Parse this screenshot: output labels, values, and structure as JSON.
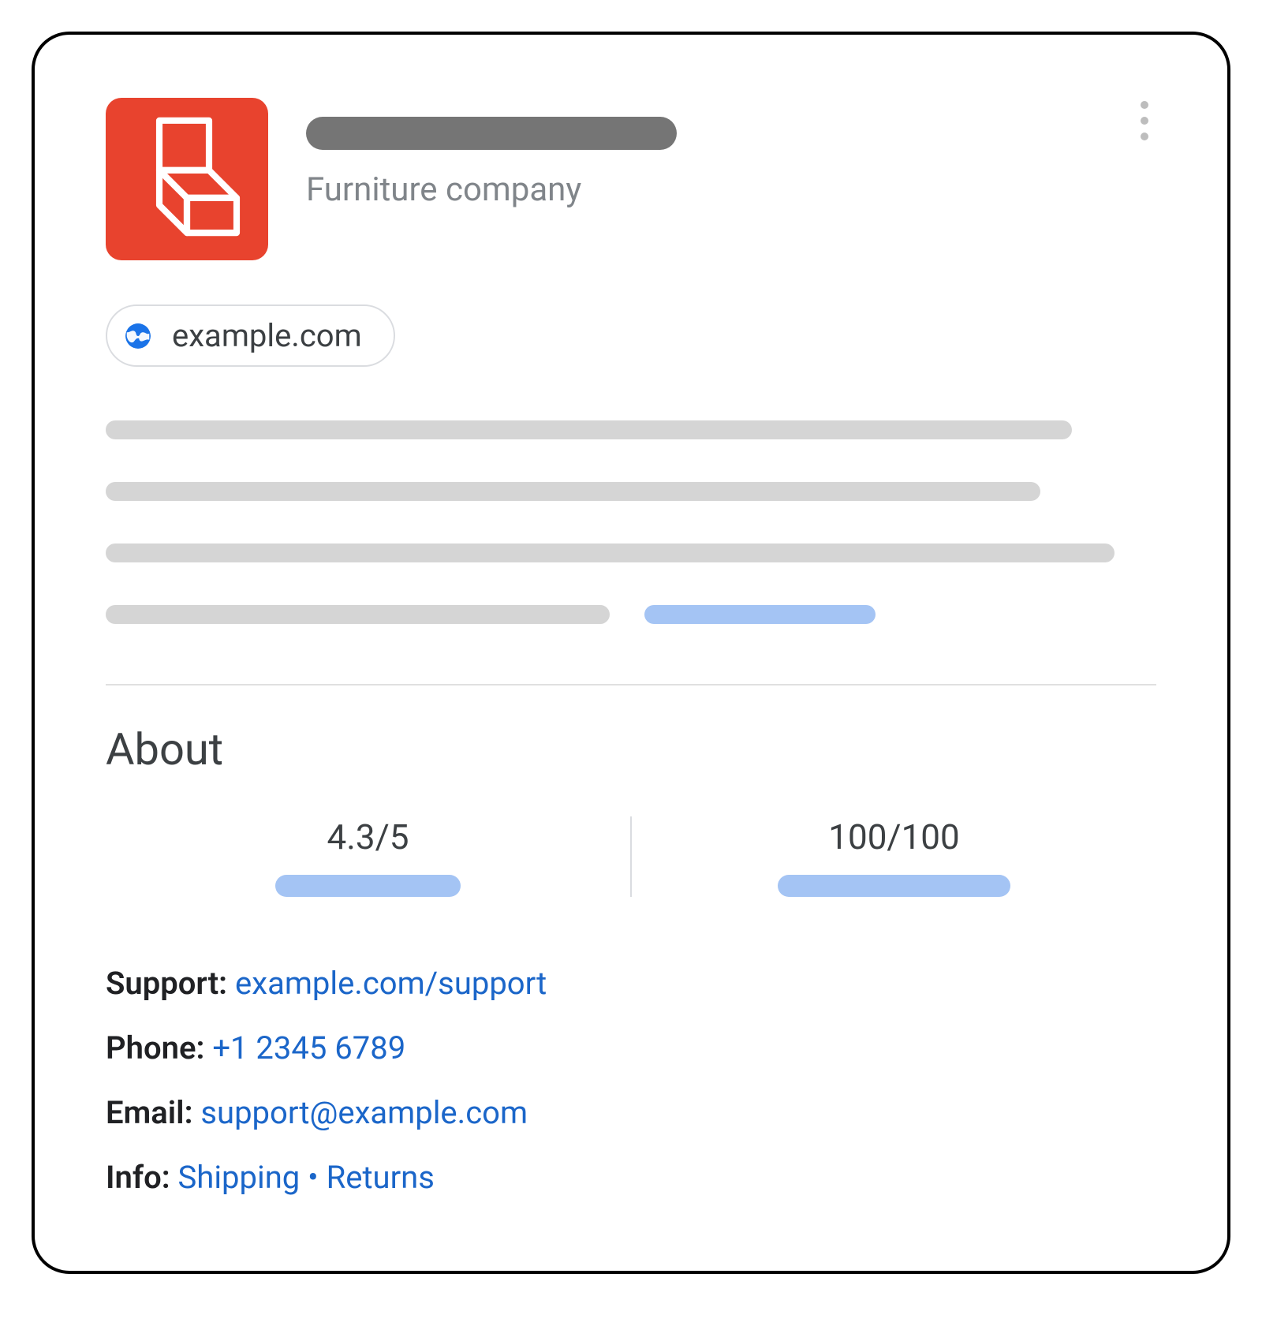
{
  "header": {
    "subtitle": "Furniture company"
  },
  "website_chip": {
    "label": "example.com"
  },
  "about": {
    "heading": "About",
    "stats": [
      {
        "value": "4.3/5"
      },
      {
        "value": "100/100"
      }
    ]
  },
  "contact": {
    "support": {
      "label": "Support:",
      "link": "example.com/support"
    },
    "phone": {
      "label": "Phone:",
      "link": "+1 2345 6789"
    },
    "email": {
      "label": "Email:",
      "link": "support@example.com"
    },
    "info": {
      "label": "Info:",
      "link1": "Shipping",
      "sep": " • ",
      "link2": "Returns"
    }
  }
}
